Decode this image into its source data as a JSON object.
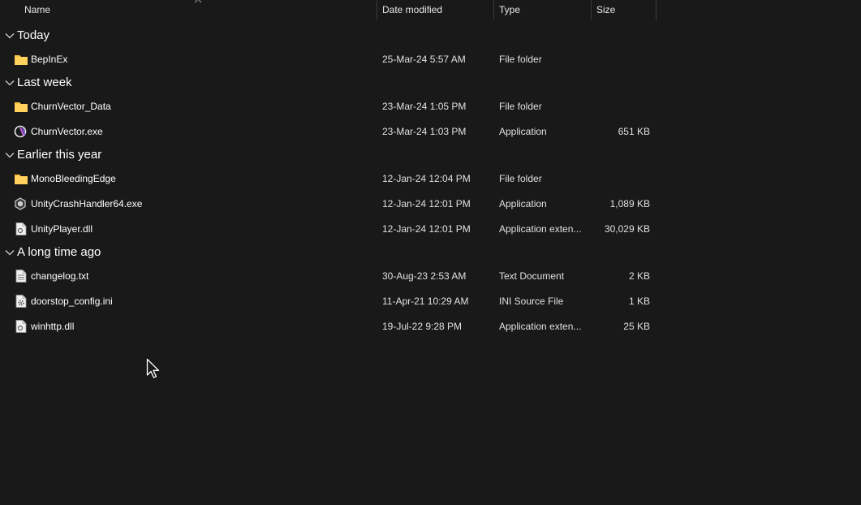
{
  "columns": {
    "name": "Name",
    "date": "Date modified",
    "type": "Type",
    "size": "Size"
  },
  "groups": [
    {
      "label": "Today",
      "files": [
        {
          "name": "BepInEx",
          "date": "25-Mar-24 5:57 AM",
          "type": "File folder",
          "size": "",
          "icon": "folder-icon"
        }
      ]
    },
    {
      "label": "Last week",
      "files": [
        {
          "name": "ChurnVector_Data",
          "date": "23-Mar-24 1:05 PM",
          "type": "File folder",
          "size": "",
          "icon": "folder-icon"
        },
        {
          "name": "ChurnVector.exe",
          "date": "23-Mar-24 1:03 PM",
          "type": "Application",
          "size": "651 KB",
          "icon": "app-logo-icon"
        }
      ]
    },
    {
      "label": "Earlier this year",
      "files": [
        {
          "name": "MonoBleedingEdge",
          "date": "12-Jan-24 12:04 PM",
          "type": "File folder",
          "size": "",
          "icon": "folder-icon"
        },
        {
          "name": "UnityCrashHandler64.exe",
          "date": "12-Jan-24 12:01 PM",
          "type": "Application",
          "size": "1,089 KB",
          "icon": "unity-icon"
        },
        {
          "name": "UnityPlayer.dll",
          "date": "12-Jan-24 12:01 PM",
          "type": "Application exten...",
          "size": "30,029 KB",
          "icon": "dll-file-icon"
        }
      ]
    },
    {
      "label": "A long time ago",
      "files": [
        {
          "name": "changelog.txt",
          "date": "30-Aug-23 2:53 AM",
          "type": "Text Document",
          "size": "2 KB",
          "icon": "text-file-icon"
        },
        {
          "name": "doorstop_config.ini",
          "date": "11-Apr-21 10:29 AM",
          "type": "INI Source File",
          "size": "1 KB",
          "icon": "ini-file-icon"
        },
        {
          "name": "winhttp.dll",
          "date": "19-Jul-22 9:28 PM",
          "type": "Application exten...",
          "size": "25 KB",
          "icon": "dll-file-icon"
        }
      ]
    }
  ],
  "colors": {
    "background": "#191919",
    "folder": "#f5c542",
    "text": "#ffffff"
  }
}
